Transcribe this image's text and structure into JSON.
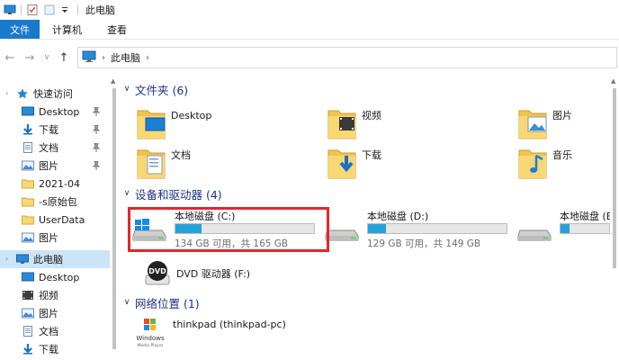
{
  "window": {
    "title": "此电脑"
  },
  "ribbon": {
    "tabs": [
      "文件",
      "计算机",
      "查看"
    ]
  },
  "address": {
    "path": "此电脑"
  },
  "sidebar": {
    "items": [
      {
        "label": "快速访问",
        "icon": "star-icon",
        "pinned": false,
        "level": 0
      },
      {
        "label": "Desktop",
        "icon": "desktop-icon",
        "pinned": true,
        "level": 1
      },
      {
        "label": "下载",
        "icon": "download-icon",
        "pinned": true,
        "level": 1
      },
      {
        "label": "文档",
        "icon": "document-icon",
        "pinned": true,
        "level": 1
      },
      {
        "label": "图片",
        "icon": "picture-icon",
        "pinned": true,
        "level": 1
      },
      {
        "label": "2021-04",
        "icon": "folder-icon",
        "pinned": false,
        "level": 1
      },
      {
        "label": "-s原始包",
        "icon": "folder-icon",
        "pinned": false,
        "level": 1
      },
      {
        "label": "UserData",
        "icon": "folder-icon",
        "pinned": false,
        "level": 1
      },
      {
        "label": "图片",
        "icon": "picture-icon",
        "pinned": false,
        "level": 1
      },
      {
        "label": "此电脑",
        "icon": "computer-icon",
        "pinned": false,
        "level": 0,
        "selected": true
      },
      {
        "label": "Desktop",
        "icon": "desktop-icon",
        "pinned": false,
        "level": 1
      },
      {
        "label": "视频",
        "icon": "video-icon",
        "pinned": false,
        "level": 1
      },
      {
        "label": "图片",
        "icon": "picture-icon",
        "pinned": false,
        "level": 1
      },
      {
        "label": "文档",
        "icon": "document-icon",
        "pinned": false,
        "level": 1
      },
      {
        "label": "下载",
        "icon": "download-icon",
        "pinned": false,
        "level": 1
      }
    ]
  },
  "groups": {
    "folders": {
      "title": "文件夹 (6)"
    },
    "drives": {
      "title": "设备和驱动器 (4)"
    },
    "network": {
      "title": "网络位置 (1)"
    }
  },
  "folders": [
    {
      "label": "Desktop",
      "icon": "desktop-folder-icon"
    },
    {
      "label": "视频",
      "icon": "video-folder-icon"
    },
    {
      "label": "图片",
      "icon": "picture-folder-icon"
    },
    {
      "label": "文档",
      "icon": "document-folder-icon"
    },
    {
      "label": "下载",
      "icon": "download-folder-icon"
    },
    {
      "label": "音乐",
      "icon": "music-folder-icon"
    }
  ],
  "drives": [
    {
      "name": "本地磁盘 (C:)",
      "space": "134 GB 可用，共 165 GB",
      "used_fraction": 0.19,
      "icon": "windows-drive-icon"
    },
    {
      "name": "本地磁盘 (D:)",
      "space": "129 GB 可用，共 149 GB",
      "used_fraction": 0.13,
      "icon": "hard-drive-icon"
    },
    {
      "name": "本地磁盘 (E:)",
      "space": "",
      "used_fraction": 0.18,
      "icon": "hard-drive-icon"
    }
  ],
  "dvd": {
    "name": "DVD 驱动器 (F:)",
    "icon_text": "DVD"
  },
  "network": {
    "name": "thinkpad (thinkpad-pc)",
    "icon_text": "Windows",
    "icon_subtext": "Media Player"
  },
  "colors": {
    "accent": "#1979ca",
    "bar_fill": "#26a0da",
    "highlight": "#e3262b",
    "group_header": "#1e3287",
    "selected": "#cce4f7"
  }
}
